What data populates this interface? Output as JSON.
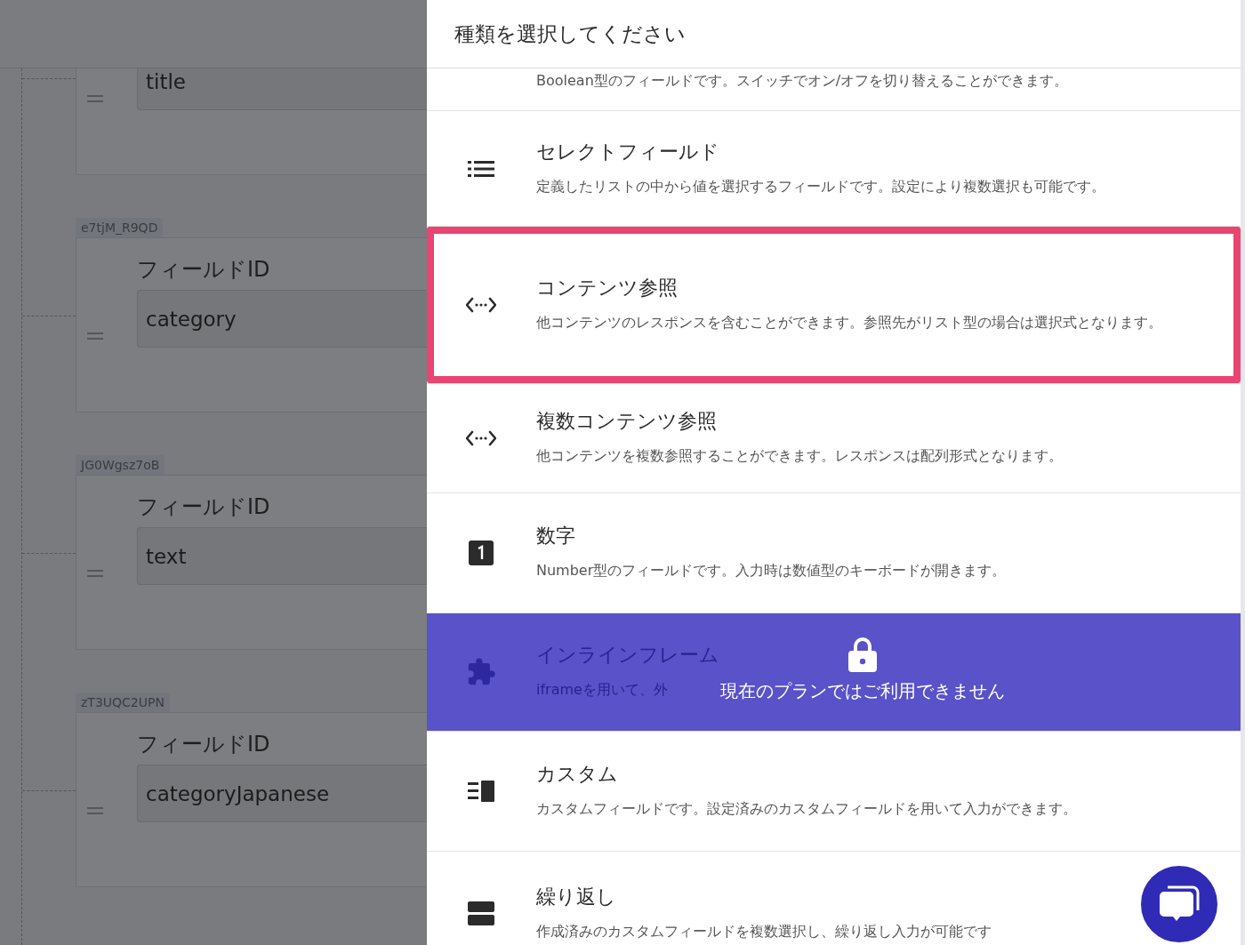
{
  "background_page": {
    "cards": [
      {
        "value": "title"
      },
      {
        "tag": "e7tjM_R9QD",
        "label": "フィールドID",
        "value": "category"
      },
      {
        "tag": "JG0Wgsz7oB",
        "label": "フィールドID",
        "value": "text"
      },
      {
        "tag": "zT3UQC2UPN",
        "label": "フィールドID",
        "value": "categoryJapanese"
      }
    ]
  },
  "dialog": {
    "title": "種類を選択してください",
    "types": [
      {
        "description": "Boolean型のフィールドです。スイッチでオン/オフを切り替えることができます。",
        "locked": false,
        "highlighted": false
      },
      {
        "title": "セレクトフィールド",
        "description": "定義したリストの中から値を選択するフィールドです。設定により複数選択も可能です。",
        "locked": false,
        "highlighted": false
      },
      {
        "title": "コンテンツ参照",
        "description": "他コンテンツのレスポンスを含むことができます。参照先がリスト型の場合は選択式となります。",
        "locked": false,
        "highlighted": true
      },
      {
        "title": "複数コンテンツ参照",
        "description": "他コンテンツを複数参照することができます。レスポンスは配列形式となります。",
        "locked": false,
        "highlighted": false
      },
      {
        "title": "数字",
        "description": "Number型のフィールドです。入力時は数値型のキーボードが開きます。",
        "locked": false,
        "highlighted": false
      },
      {
        "title": "インラインフレーム",
        "description": "iframeを用いて、外",
        "locked": true,
        "lock_message": "現在のプランではご利用できません",
        "highlighted": false
      },
      {
        "title": "カスタム",
        "description": "カスタムフィールドです。設定済みのカスタムフィールドを用いて入力ができます。",
        "locked": false,
        "highlighted": false
      },
      {
        "title": "繰り返し",
        "description": "作成済みのカスタムフィールドを複数選択し、繰り返し入力が可能です",
        "locked": false,
        "highlighted": false
      }
    ]
  }
}
